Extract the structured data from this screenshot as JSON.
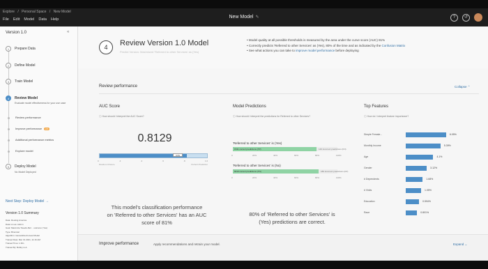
{
  "window": {
    "breadcrumb": [
      "Explore",
      "/",
      "Personal Space",
      "/",
      "New Model"
    ],
    "menu": [
      "File",
      "Edit",
      "Model",
      "Data",
      "Help"
    ],
    "title": "New Model",
    "pencil": "✎",
    "icons": [
      "help-icon",
      "history-icon",
      "avatar"
    ]
  },
  "sidebar": {
    "version": "Version 1.0",
    "collapse_icon": "«",
    "steps": [
      {
        "num": "1",
        "label": "Prepare Data"
      },
      {
        "num": "2",
        "label": "Define Model"
      },
      {
        "num": "3",
        "label": "Train Model"
      },
      {
        "num": "4",
        "label": "Review Model",
        "sub": "Evaluate model effectiveness for your use case"
      },
      {
        "num": "5",
        "label": "Deploy Model",
        "sub": "No Model Deployed"
      }
    ],
    "substeps": [
      "Review performance",
      "Improve performance",
      "Additional performance metrics",
      "Explore model"
    ],
    "improve_badge": "2/4",
    "next_step": "Next Step: Deploy Model →",
    "summary_title": "Version 1.0 Summary",
    "summary_lines": [
      "Data: Routing America",
      "Data run as: Admin",
      "Goal: Maximize 'Needs-Ref… outcome' (Yes)",
      "Type: Binomial",
      "Algorithm: Generalized Linear Model",
      "Trained Date: Mar 31 2021, 11:16 AM",
      "Trained Time: 1 Min",
      "Trained By: Bobby H-A"
    ]
  },
  "header": {
    "step_num": "4",
    "title": "Review Version 1.0 Model",
    "subtitle": "Predict Version: Maximized 'Referred to other Services' as (Yes)",
    "bullets": [
      {
        "text": "Model quality at all possible thresholds is measured by the area under the curve score (AUC) 81%"
      },
      {
        "text": "Correctly predicts 'Referred to other Services' as (Yes), 80% of the time and as indicated by the ",
        "link": "Confusion Matrix"
      },
      {
        "text": "See what actions you can take to ",
        "link": "improve model performance",
        "tail": " before deploying"
      }
    ]
  },
  "review": {
    "title": "Review performance",
    "collapse": "Collapse ⌃"
  },
  "auc": {
    "title": "AUC Score",
    "question": "ⓘ How should I interpret the AUC Score?",
    "value": "0.8129",
    "fraction": 0.8129,
    "tag": "0.81",
    "ticks": [
      "0",
      ".2",
      ".4",
      ".6",
      ".8",
      "1.0"
    ],
    "left_end": "Random Chance",
    "right_end": "Perfect Prediction",
    "caption_line1": "This model's classification performance",
    "caption_line2": "on 'Referred to other Services' has an AUC",
    "caption_line3": "score of 81%"
  },
  "predictions": {
    "title": "Model Predictions",
    "question": "ⓘ How should I interpret the predictions for Referred to other Services?",
    "yes_title": "'Referred to other Services' is (Yes)",
    "yes_correct": "1541 correct predictions (TP)",
    "yes_incorrect": "146 incorrect predictions (FN)",
    "yes_fraction": 0.8,
    "no_title": "'Referred to other Services' is (No)",
    "no_correct": "8319 correct predictions (TN)",
    "no_incorrect": "186 incorrect predictions (FP)",
    "no_fraction": 0.82,
    "ticks": [
      "0",
      "20%",
      "40%",
      "60%",
      "80%",
      "100%"
    ],
    "caption_line1": "80% of 'Referred to other Services' is",
    "caption_line2": "(Yes) predictions are correct."
  },
  "features": {
    "title": "Top Features",
    "question": "ⓘ How do I interpret feature importance?",
    "rows": [
      {
        "name": "Simple Female...",
        "value": "6.05%",
        "fraction": 1.0
      },
      {
        "name": "Monthly Income",
        "value": "5.39%",
        "fraction": 0.86
      },
      {
        "name": "Age",
        "value": "4.1%",
        "fraction": 0.68
      },
      {
        "name": "Gender",
        "value": "3.12%",
        "fraction": 0.52
      },
      {
        "name": "# Dependents",
        "value": "1.68%",
        "fraction": 0.42
      },
      {
        "name": "# Visits",
        "value": "1.05%",
        "fraction": 0.38
      },
      {
        "name": "Education",
        "value": "0.594%",
        "fraction": 0.33
      },
      {
        "name": "Race",
        "value": "0.801%",
        "fraction": 0.28
      }
    ]
  },
  "improve": {
    "title": "Improve performance",
    "subtitle": "Apply recommendations and retrain your model.",
    "expand": "Expand ⌄"
  }
}
